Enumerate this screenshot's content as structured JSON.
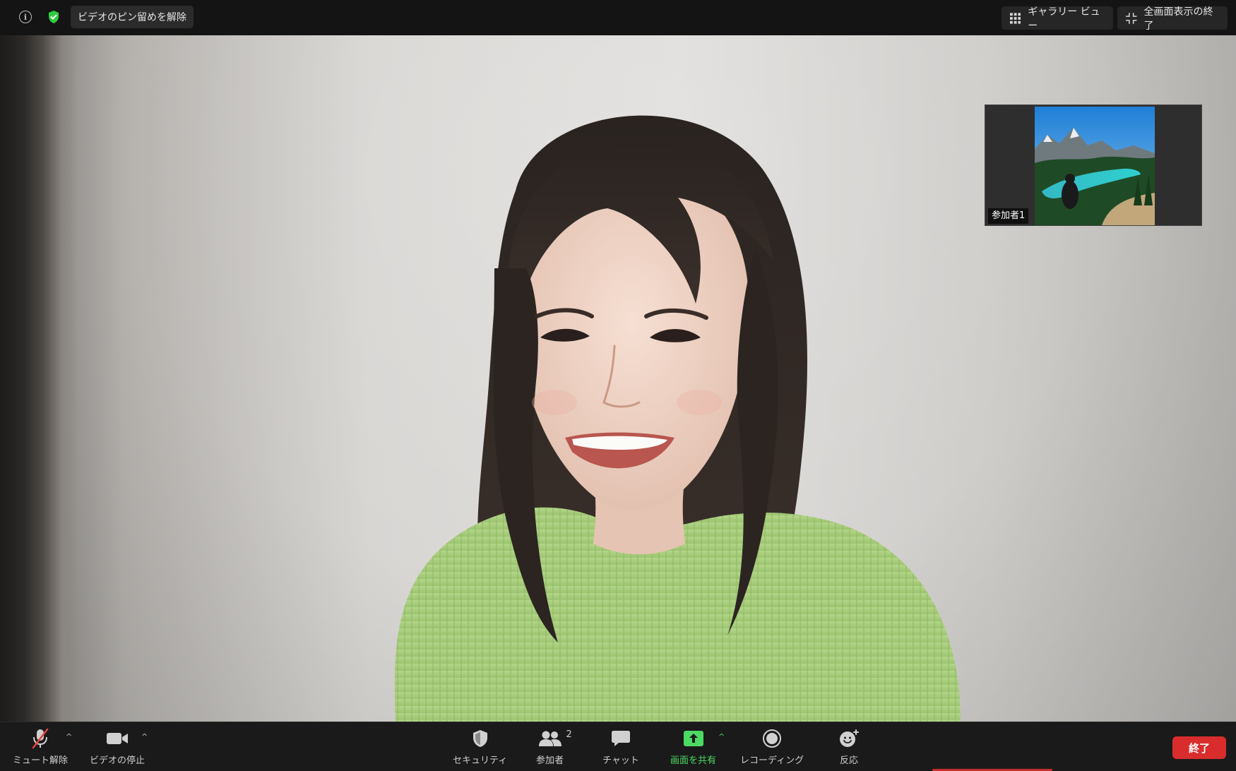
{
  "topbar": {
    "unpin_label": "ビデオのピン留めを解除",
    "gallery_label": "ギャラリー ビュー",
    "exit_fullscreen_label": "全画面表示の終了"
  },
  "thumbnail": {
    "participant_name": "参加者1"
  },
  "toolbar": {
    "unmute_label": "ミュート解除",
    "stop_video_label": "ビデオの停止",
    "security_label": "セキュリティ",
    "participants_label": "参加者",
    "participants_count": "2",
    "chat_label": "チャット",
    "share_screen_label": "画面を共有",
    "recording_label": "レコーディング",
    "reactions_label": "反応",
    "end_label": "終了"
  },
  "colors": {
    "share_green": "#4cd964",
    "end_red": "#d92d2d",
    "mute_red": "#e0443e"
  }
}
